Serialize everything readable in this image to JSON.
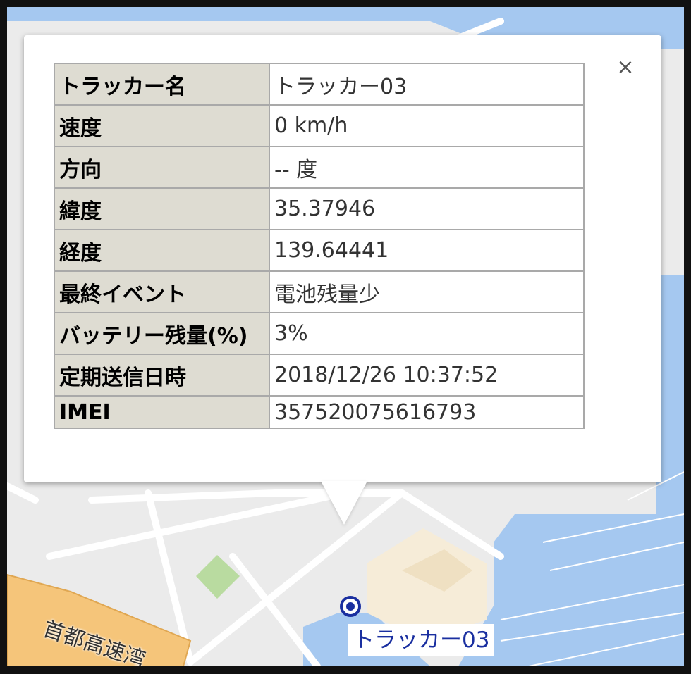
{
  "map": {
    "road_label": "首都高速湾",
    "marker_label": "トラッカー03",
    "colors": {
      "water": "#a5c8f0",
      "land": "#ebebeb",
      "road": "#ffffff",
      "highway": "#f5c57a",
      "park": "#b9dba0",
      "building": "#f6ecd8"
    }
  },
  "popup": {
    "close_icon": "close-icon",
    "rows": [
      {
        "label": "トラッカー名",
        "value": "トラッカー03"
      },
      {
        "label": "速度",
        "value": "0 km/h"
      },
      {
        "label": "方向",
        "value": "-- 度"
      },
      {
        "label": "緯度",
        "value": "35.37946"
      },
      {
        "label": "経度",
        "value": "139.64441"
      },
      {
        "label": "最終イベント",
        "value": "電池残量少"
      },
      {
        "label": "バッテリー残量(%)",
        "value": "3%"
      },
      {
        "label": "定期送信日時",
        "value": "2018/12/26 10:37:52"
      },
      {
        "label": "IMEI",
        "value": "357520075616793"
      }
    ]
  }
}
